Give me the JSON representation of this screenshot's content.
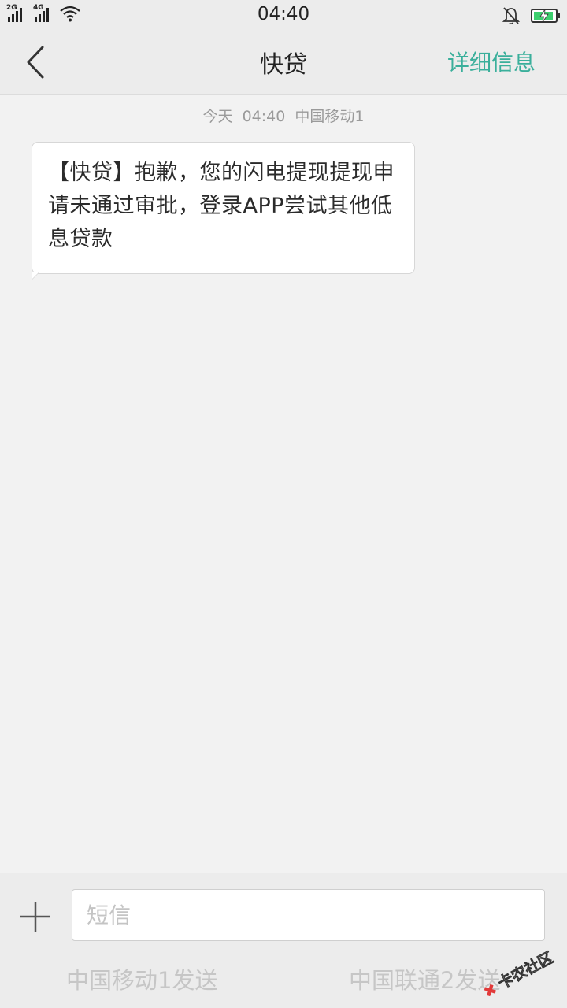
{
  "status_bar": {
    "sim1_label": "2G",
    "sim2_label": "4G",
    "time": "04:40"
  },
  "header": {
    "title": "快贷",
    "detail_label": "详细信息"
  },
  "conversation": {
    "timestamp": "今天  04:40  中国移动1",
    "messages": [
      {
        "text": "【快贷】抱歉，您的闪电提现提现申请未通过审批，登录APP尝试其他低息贷款"
      }
    ]
  },
  "composer": {
    "placeholder": "短信",
    "send_sim1_label": "中国移动1发送",
    "send_sim2_label": "中国联通2发送"
  },
  "watermark": {
    "text": "卡农社区"
  },
  "colors": {
    "accent": "#3aaf9b",
    "background": "#f2f2f2",
    "bar_background": "#ececec",
    "battery_fill": "#3ccf6e"
  },
  "icons": {
    "back": "chevron-left-icon",
    "plus": "plus-icon",
    "wifi": "wifi-icon",
    "mute": "bell-off-icon",
    "battery": "battery-charging-icon"
  }
}
